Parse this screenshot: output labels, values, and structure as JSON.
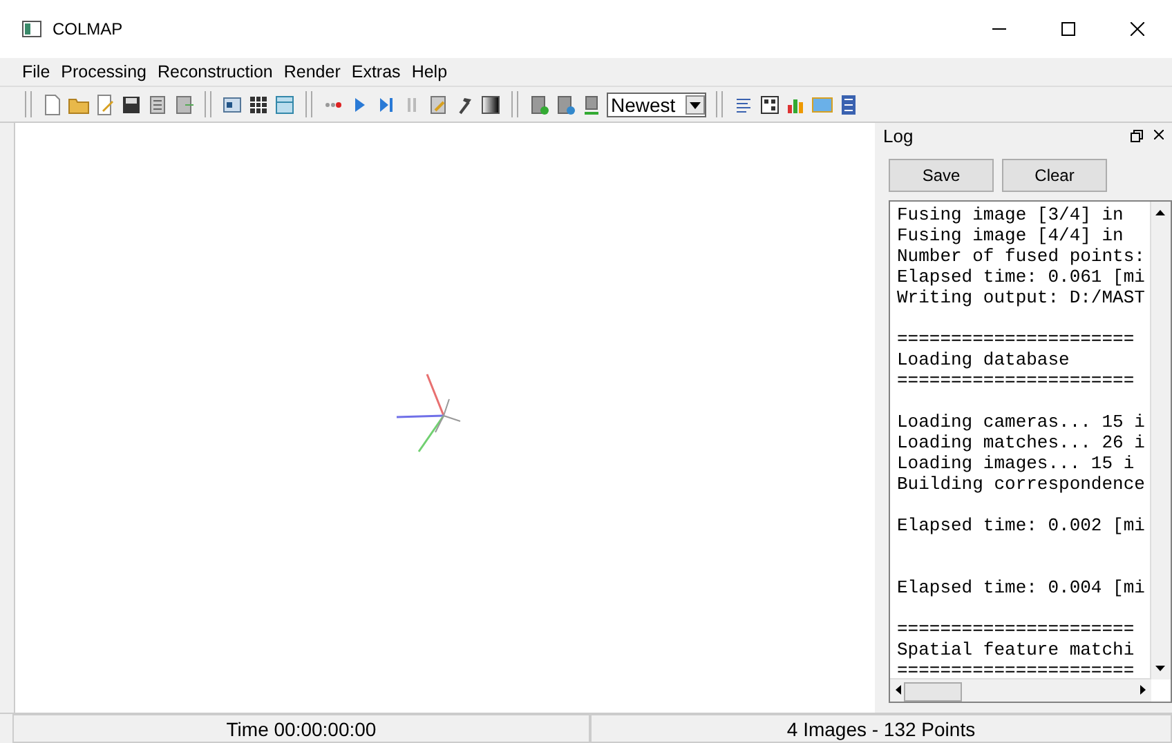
{
  "window": {
    "title": "COLMAP"
  },
  "menu": [
    "File",
    "Processing",
    "Reconstruction",
    "Render",
    "Extras",
    "Help"
  ],
  "toolbar": {
    "dropdown": {
      "value": "Newest"
    }
  },
  "log": {
    "title": "Log",
    "buttons": [
      "Save",
      "Clear"
    ],
    "lines": [
      {
        "kind": "text",
        "text": "Fusing image [3/4] in"
      },
      {
        "kind": "text",
        "text": "Fusing image [4/4] in"
      },
      {
        "kind": "text",
        "text": "Number of fused points:"
      },
      {
        "kind": "text",
        "text": "Elapsed time: 0.061 [mi"
      },
      {
        "kind": "text",
        "text": "Writing output: D:/MAST"
      },
      {
        "kind": "gap"
      },
      {
        "kind": "text",
        "text": "======================"
      },
      {
        "kind": "text",
        "text": "Loading database"
      },
      {
        "kind": "text",
        "text": "======================"
      },
      {
        "kind": "gap"
      },
      {
        "kind": "text",
        "text": "Loading cameras... 15 i"
      },
      {
        "kind": "text",
        "text": "Loading matches... 26 i"
      },
      {
        "kind": "text",
        "text": "Loading images... 15 i"
      },
      {
        "kind": "text",
        "text": "Building correspondence"
      },
      {
        "kind": "gap"
      },
      {
        "kind": "text",
        "text": "Elapsed time: 0.002 [mi"
      },
      {
        "kind": "gap"
      },
      {
        "kind": "gap"
      },
      {
        "kind": "text",
        "text": "Elapsed time: 0.004 [mi"
      },
      {
        "kind": "gap"
      },
      {
        "kind": "text",
        "text": "======================"
      },
      {
        "kind": "text",
        "text": "Spatial feature matchi"
      },
      {
        "kind": "text",
        "text": "======================"
      }
    ]
  },
  "status_bar": [
    "Time 00:00:00:00",
    "4 Images - 132 Points"
  ]
}
